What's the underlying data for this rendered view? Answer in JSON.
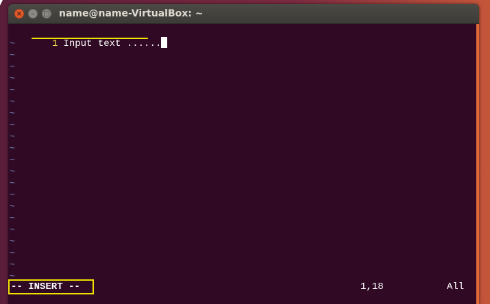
{
  "window": {
    "title": "name@name-VirtualBox: ~",
    "buttons": {
      "close": "×",
      "minimize": "–",
      "maximize": "□"
    }
  },
  "editor": {
    "lines": [
      {
        "number": "1",
        "text": "Input text ......"
      }
    ],
    "empty_line_marker": "~",
    "empty_line_count": 21
  },
  "statusbar": {
    "mode": "-- INSERT --",
    "position": "1,18",
    "scroll": "All"
  },
  "colors": {
    "terminal_bg": "#300a24",
    "line_number": "#fce94f",
    "tilde": "#7b8cc4",
    "highlight": "#f2e200",
    "close_button": "#e25a2c"
  }
}
